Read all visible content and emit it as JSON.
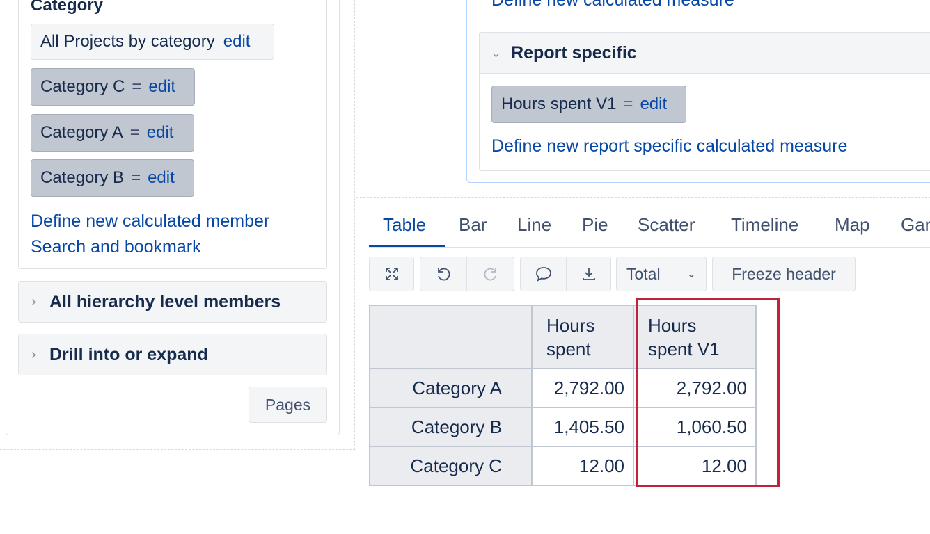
{
  "category_section": {
    "title": "Category",
    "base_chip": {
      "label": "All Projects by category",
      "edit": "edit"
    },
    "members": [
      {
        "label": "Category C",
        "eq": "=",
        "edit": "edit"
      },
      {
        "label": "Category A",
        "eq": "=",
        "edit": "edit"
      },
      {
        "label": "Category B",
        "eq": "=",
        "edit": "edit"
      }
    ],
    "define_member_link": "Define new calculated member",
    "search_bookmark_link": "Search and bookmark"
  },
  "collapsibles": [
    {
      "label": "All hierarchy level members"
    },
    {
      "label": "Drill into or expand"
    }
  ],
  "pages_button": "Pages",
  "measures_section": {
    "define_measure_link": "Define new calculated measure",
    "report_specific": {
      "title": "Report specific",
      "chip": {
        "label": "Hours spent V1",
        "eq": "=",
        "edit": "edit"
      },
      "define_link": "Define new report specific calculated measure"
    }
  },
  "tabs": [
    "Table",
    "Bar",
    "Line",
    "Pie",
    "Scatter",
    "Timeline",
    "Map",
    "Gantt"
  ],
  "active_tab": "Table",
  "toolbar": {
    "total_label": "Total",
    "freeze_header_label": "Freeze header"
  },
  "icons": {
    "fullscreen": "expand-icon",
    "undo": "undo-icon",
    "redo": "redo-icon",
    "comment": "comment-icon",
    "download": "download-icon"
  },
  "table": {
    "columns": [
      "Hours spent",
      "Hours spent V1"
    ],
    "rows": [
      {
        "label": "Category A",
        "values": [
          "2,792.00",
          "2,792.00"
        ]
      },
      {
        "label": "Category B",
        "values": [
          "1,405.50",
          "1,060.50"
        ]
      },
      {
        "label": "Category C",
        "values": [
          "12.00",
          "12.00"
        ]
      }
    ]
  },
  "colors": {
    "link": "#0747a6",
    "highlight_border": "#c2213a",
    "chip_gray": "#c1c7d0"
  }
}
